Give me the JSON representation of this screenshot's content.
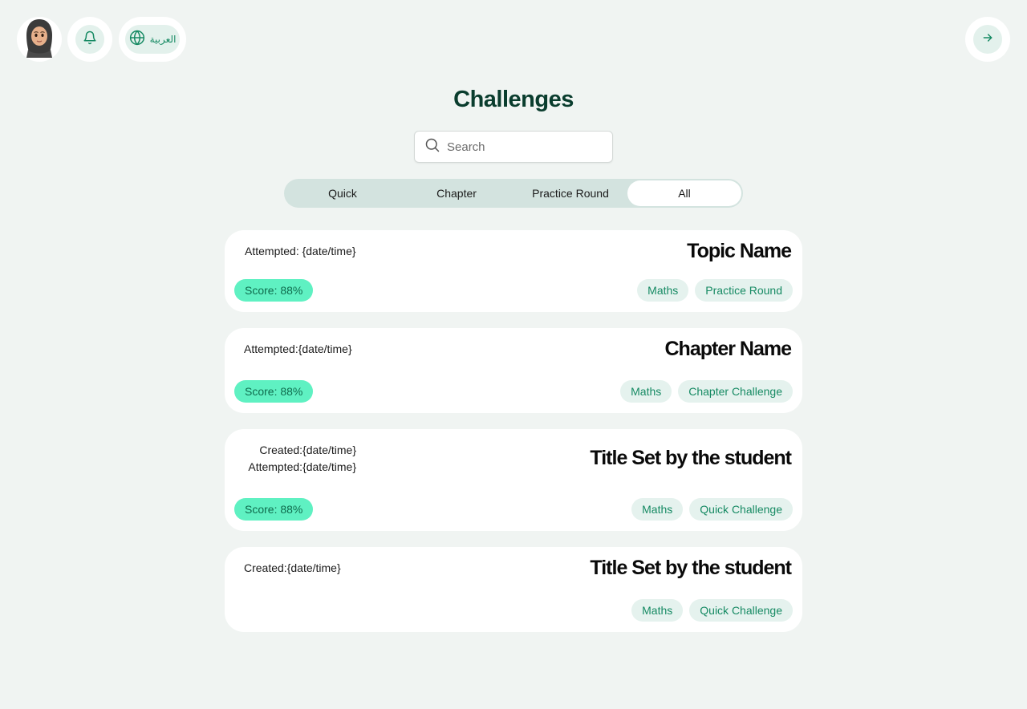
{
  "header": {
    "avatar_icon": "avatar-hijab-icon",
    "bell_icon": "bell-icon",
    "language": {
      "icon": "globe-icon",
      "label": "العربية"
    },
    "forward_icon": "arrow-right-icon"
  },
  "page": {
    "title": "Challenges",
    "search": {
      "placeholder": "Search",
      "value": ""
    }
  },
  "tabs": [
    {
      "label": "Quick",
      "active": false
    },
    {
      "label": "Chapter",
      "active": false
    },
    {
      "label": "Practice Round",
      "active": false
    },
    {
      "label": "All",
      "active": true
    }
  ],
  "cards": [
    {
      "title": "Topic Name",
      "meta": [
        "Attempted: {date/time}"
      ],
      "score": "Score: 88%",
      "tags": [
        "Maths",
        "Practice Round"
      ]
    },
    {
      "title": "Chapter Name",
      "meta": [
        "Attempted:{date/time}"
      ],
      "score": "Score: 88%",
      "tags": [
        "Maths",
        "Chapter Challenge"
      ]
    },
    {
      "title": "Title Set by the student",
      "meta": [
        "Created:{date/time}",
        "Attempted:{date/time}"
      ],
      "score": "Score: 88%",
      "tags": [
        "Maths",
        "Quick Challenge"
      ]
    },
    {
      "title": "Title Set by the student",
      "meta": [
        "Created:{date/time}"
      ],
      "score": "",
      "tags": [
        "Maths",
        "Quick Challenge"
      ]
    }
  ],
  "colors": {
    "background": "#f0f4f2",
    "accent": "#168a63",
    "score_bg": "#5ff1c2",
    "tag_bg": "#e5f2ee"
  }
}
